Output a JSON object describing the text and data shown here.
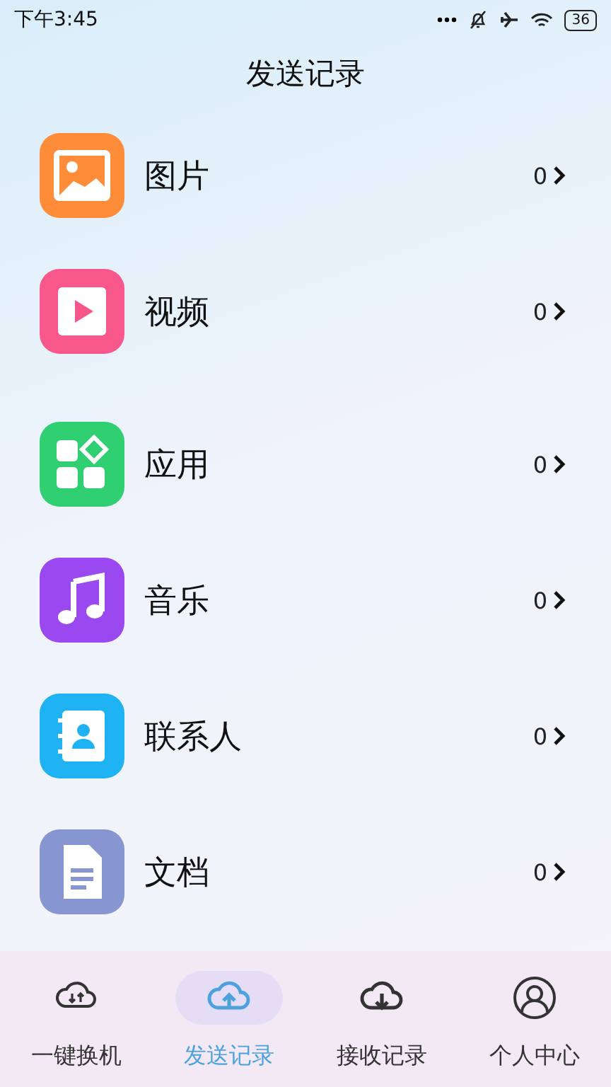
{
  "status_bar": {
    "time": "下午3:45",
    "battery": "36"
  },
  "title": "发送记录",
  "categories": [
    {
      "kind": "image",
      "label": "图片",
      "count": "0",
      "color": "#ff8c38"
    },
    {
      "kind": "video",
      "label": "视频",
      "count": "0",
      "color": "#f7578a"
    },
    {
      "kind": "app",
      "label": "应用",
      "count": "0",
      "color": "#2fcf72"
    },
    {
      "kind": "music",
      "label": "音乐",
      "count": "0",
      "color": "#9a48ef"
    },
    {
      "kind": "contact",
      "label": "联系人",
      "count": "0",
      "color": "#1fb2f2"
    },
    {
      "kind": "document",
      "label": "文档",
      "count": "0",
      "color": "#8796d0"
    }
  ],
  "nav": [
    {
      "kind": "transfer",
      "label": "一键换机",
      "selected": false
    },
    {
      "kind": "upload",
      "label": "发送记录",
      "selected": true
    },
    {
      "kind": "download",
      "label": "接收记录",
      "selected": false
    },
    {
      "kind": "person",
      "label": "个人中心",
      "selected": false
    }
  ]
}
